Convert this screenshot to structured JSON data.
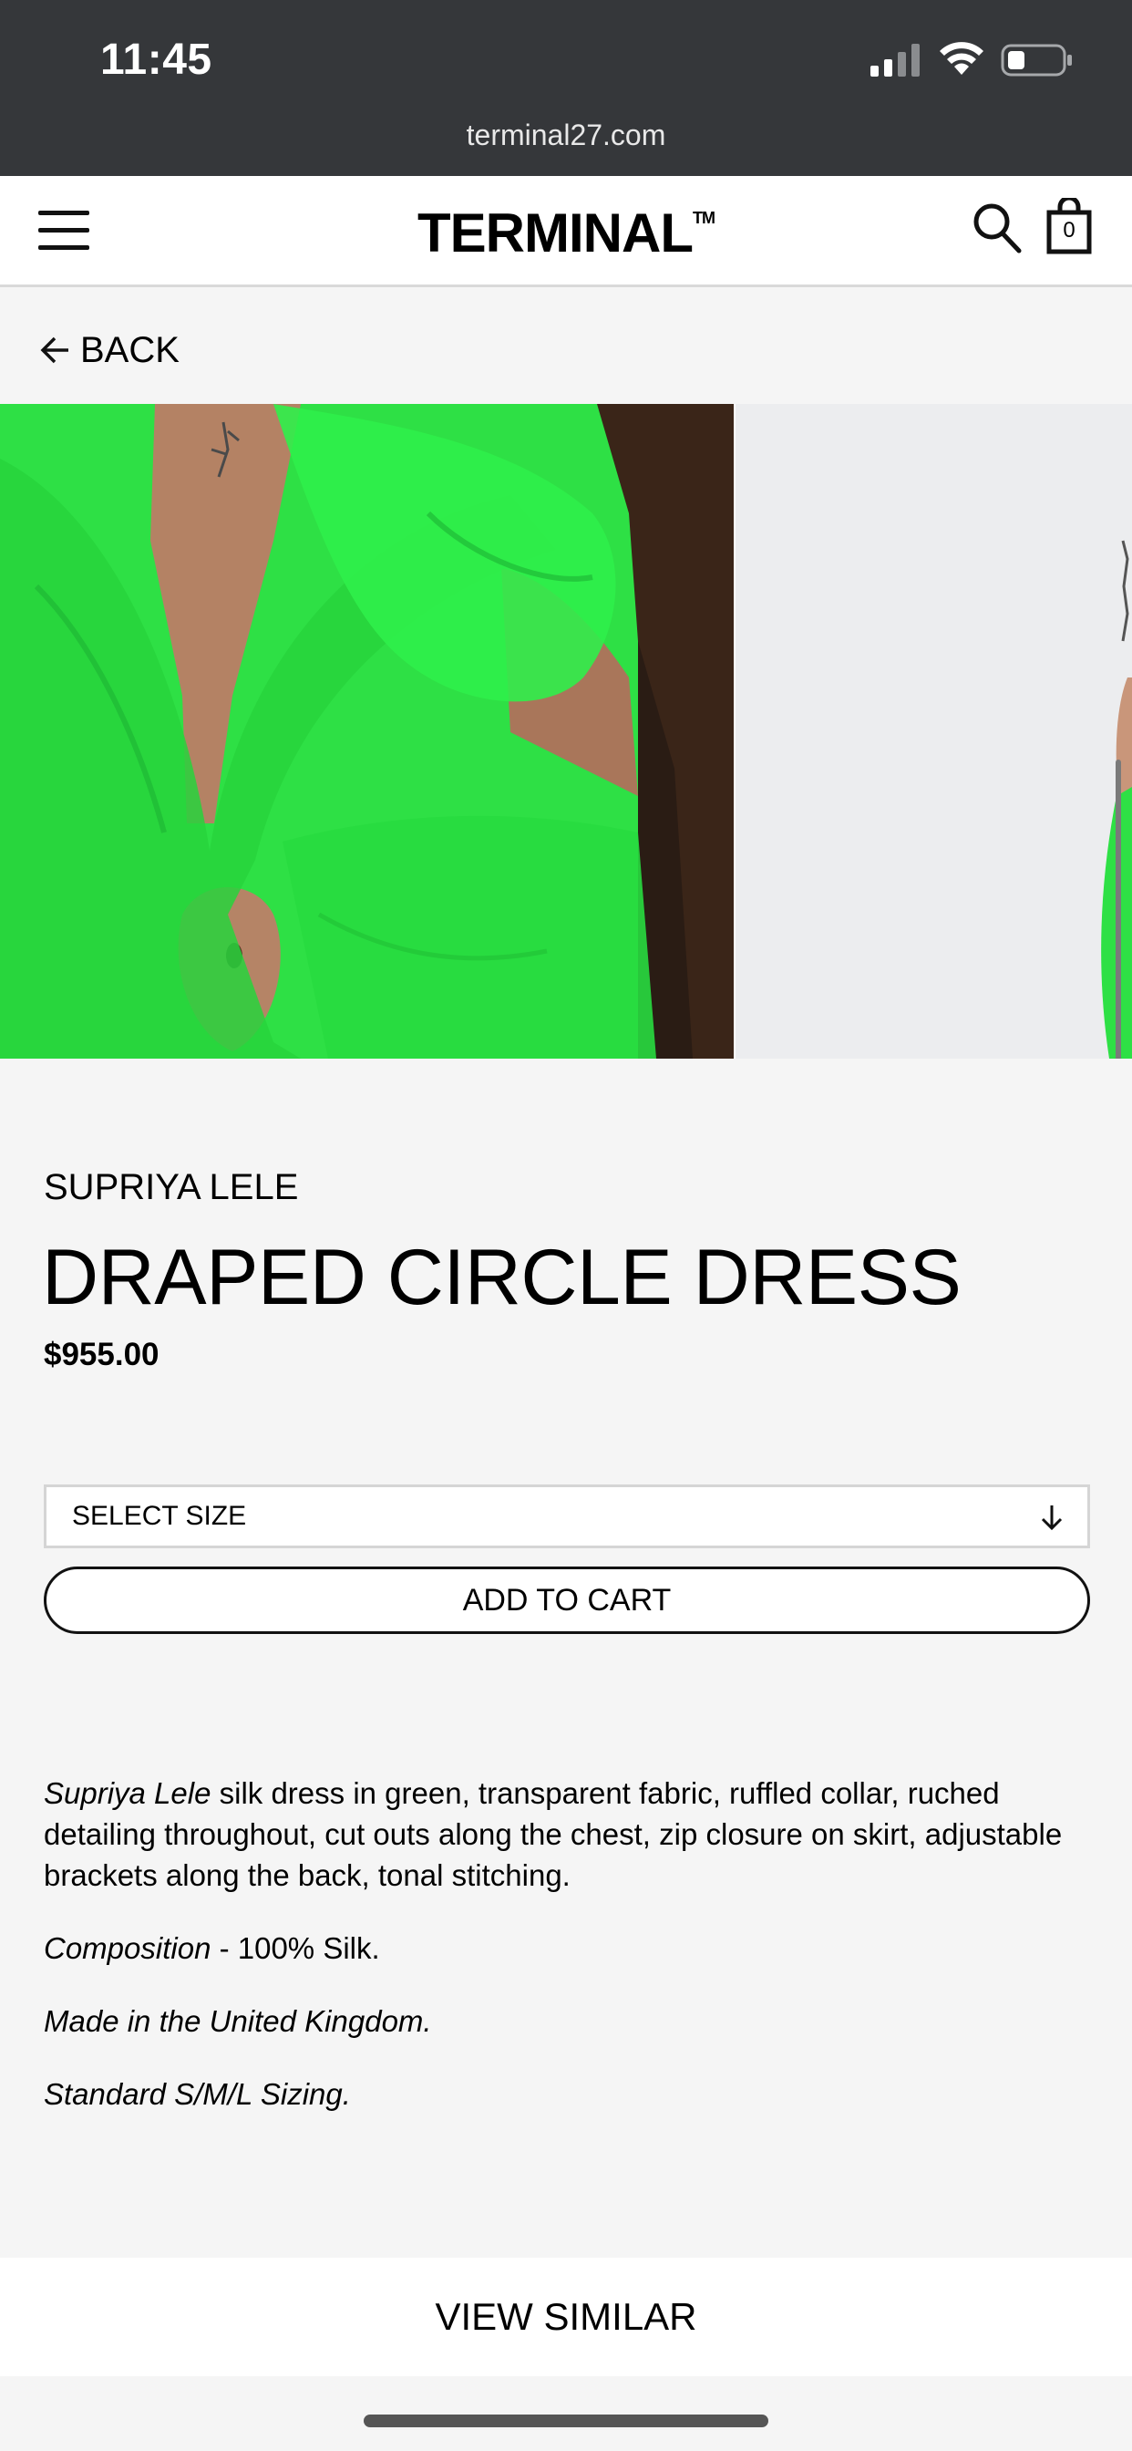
{
  "status_bar": {
    "time": "11:45"
  },
  "browser": {
    "url": "terminal27.com"
  },
  "header": {
    "logo": "TERMINAL",
    "logo_mark": "TM",
    "cart_count": "0"
  },
  "nav": {
    "back_label": "BACK"
  },
  "product": {
    "brand": "SUPRIYA LELE",
    "title": "DRAPED CIRCLE DRESS",
    "price": "$955.00",
    "size_placeholder": "SELECT SIZE",
    "add_to_cart": "ADD TO CART",
    "description": {
      "brand_italic": "Supriya Lele",
      "main": " silk dress in green, transparent fabric, ruffled collar, ruched detailing throughout, cut outs along the chest, zip closure on skirt, adjustable brackets along the back, tonal stitching.",
      "composition_label": "Composition",
      "composition_value": " - 100% Silk.",
      "origin": "Made in the United Kingdom.",
      "sizing": "Standard S/M/L Sizing."
    }
  },
  "footer": {
    "view_similar": "VIEW SIMILAR"
  },
  "colors": {
    "chrome": "#35373a",
    "dress_green": "#2ee045",
    "background": "#f5f5f5"
  }
}
